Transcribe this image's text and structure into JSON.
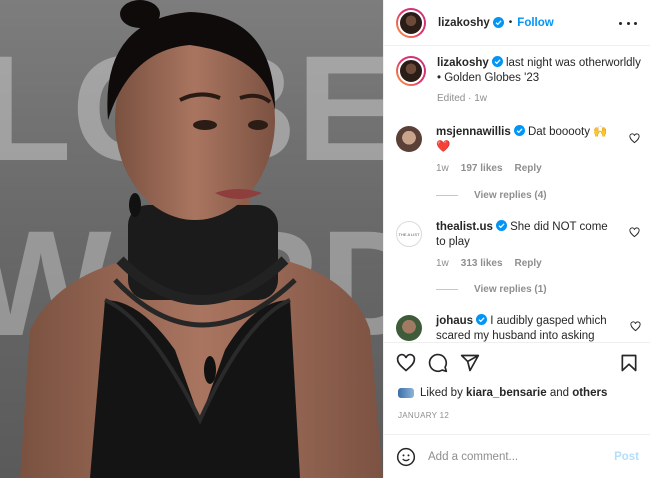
{
  "photo": {
    "background_text_line1": "LOBE",
    "background_text_line2": "WARDS",
    "description_colors": {
      "background": "#6e6e6e",
      "dress": "#121212",
      "skin": "#9a6a52"
    }
  },
  "post": {
    "author": "lizakoshy",
    "follow_label": "Follow",
    "separator": "•",
    "caption": "last night was otherworldly • Golden Globes '23",
    "edited": "Edited",
    "time": "1w",
    "liked_by_prefix": "Liked by",
    "liked_by_user": "kiara_bensarie",
    "liked_by_conj": "and",
    "liked_by_suffix": "others",
    "date": "JANUARY 12"
  },
  "comments": [
    {
      "user": "msjennawillis",
      "text": "Dat booooty 🙌❤️",
      "time": "1w",
      "likes": "197 likes",
      "reply": "Reply",
      "view_replies": "View replies (4)"
    },
    {
      "user": "thealist.us",
      "text": "She did NOT come to play",
      "time": "1w",
      "likes": "313 likes",
      "reply": "Reply",
      "view_replies": "View replies (1)",
      "avatar_text": "THE A LIST"
    },
    {
      "user": "johaus",
      "text": "I audibly gasped which scared my husband into asking"
    }
  ],
  "comment_box": {
    "placeholder": "Add a comment...",
    "post_label": "Post"
  },
  "icons": {
    "verified": "verified-badge-icon",
    "more": "more-options-icon",
    "like": "heart-icon",
    "comment": "comment-bubble-icon",
    "share": "paper-plane-icon",
    "save": "bookmark-icon",
    "emoji": "emoji-smiley-icon"
  },
  "colors": {
    "accent": "#0095f6",
    "verified": "#0095f6",
    "muted": "#8e8e8e",
    "post_disabled": "#b2dffc"
  }
}
